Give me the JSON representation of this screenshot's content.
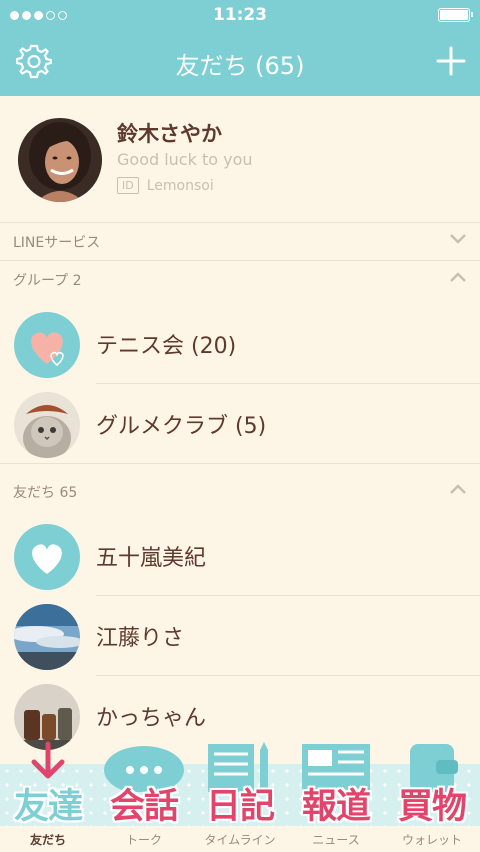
{
  "status_bar": {
    "time": "11:23",
    "signal_bars": 3,
    "signal_total": 5
  },
  "header": {
    "title": "友だち (65)",
    "settings_icon": "gear-icon",
    "add_icon": "plus-icon"
  },
  "profile": {
    "name": "鈴木さやか",
    "status": "Good luck to you",
    "id_label": "ID",
    "id_value": "Lemonsoi"
  },
  "sections": {
    "line_services": {
      "label": "LINEサービス",
      "state": "collapsed"
    },
    "groups": {
      "label": "グループ 2",
      "state": "expanded"
    },
    "friends": {
      "label": "友だち 65",
      "state": "expanded"
    }
  },
  "groups": [
    {
      "name": "テニス会 (20)",
      "avatar": "heart-icon"
    },
    {
      "name": "グルメクラブ (5)",
      "avatar": "cat-photo"
    }
  ],
  "friends": [
    {
      "name": "五十嵐美紀",
      "avatar": "heart-icon"
    },
    {
      "name": "江藤りさ",
      "avatar": "sky-photo"
    },
    {
      "name": "かっちゃん",
      "avatar": "jars-photo"
    }
  ],
  "tabs": [
    {
      "big": "友達",
      "small": "友だち",
      "icon": "download-arrow-icon",
      "active": true
    },
    {
      "big": "会話",
      "small": "トーク",
      "icon": "speech-bubble-icon",
      "active": false
    },
    {
      "big": "日記",
      "small": "タイムライン",
      "icon": "notebook-pencil-icon",
      "active": false
    },
    {
      "big": "報道",
      "small": "ニュース",
      "icon": "newspaper-icon",
      "active": false
    },
    {
      "big": "買物",
      "small": "ウォレット",
      "icon": "wallet-icon",
      "active": false
    }
  ],
  "colors": {
    "accent": "#7dcfd3",
    "background": "#fdf6e6",
    "text": "#5e3a2e",
    "tab_highlight": "#e2456b"
  }
}
